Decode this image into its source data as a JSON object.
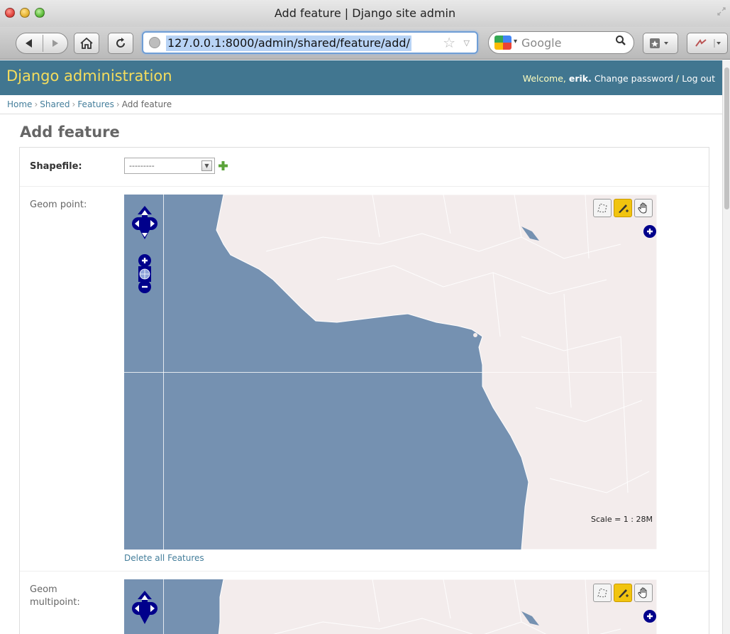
{
  "window": {
    "title": "Add feature | Django site admin"
  },
  "browser": {
    "url": "127.0.0.1:8000/admin/shared/feature/add/",
    "search_engine": "Google",
    "accent": "#6f9ed6"
  },
  "header": {
    "brand": "Django administration",
    "welcome": "Welcome,",
    "username": "erik.",
    "change_password": "Change password",
    "separator": "/",
    "logout": "Log out",
    "color": "#417690"
  },
  "breadcrumbs": [
    {
      "label": "Home"
    },
    {
      "label": "Shared"
    },
    {
      "label": "Features"
    },
    {
      "label": "Add feature"
    }
  ],
  "page": {
    "title": "Add feature"
  },
  "form": {
    "shapefile": {
      "label": "Shapefile:",
      "value": "---------"
    },
    "geom_point": {
      "label": "Geom point:",
      "scale": "Scale = 1 : 28M",
      "delete_link": "Delete all Features"
    },
    "geom_multipoint": {
      "label": "Geom multipoint:"
    }
  },
  "icons": [
    "back-icon",
    "forward-icon",
    "home-icon",
    "reload-icon",
    "globe-icon",
    "star-icon",
    "search-icon",
    "bookmark-icon",
    "extension-icon",
    "add-icon",
    "pan-icon",
    "zoom-in-icon",
    "zoom-out-icon",
    "world-icon",
    "polygon-tool-icon",
    "draw-point-icon",
    "hand-tool-icon"
  ]
}
